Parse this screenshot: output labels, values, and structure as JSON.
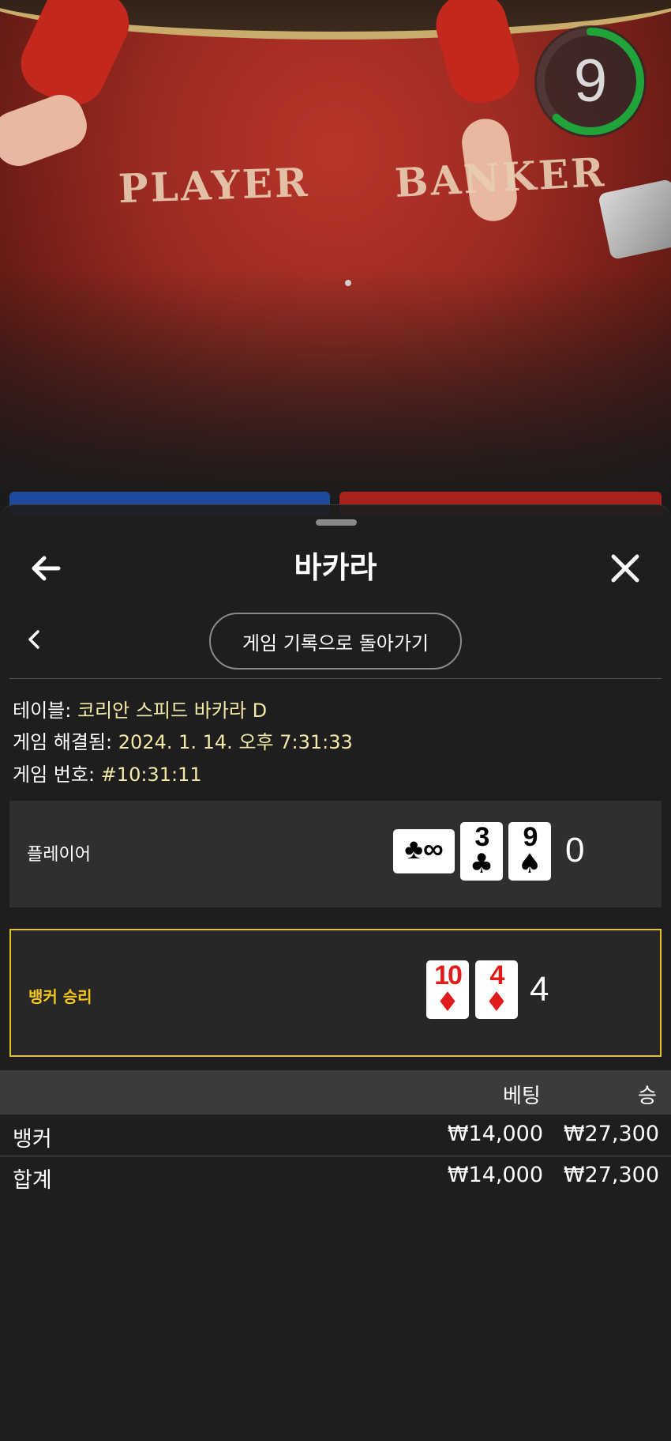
{
  "video": {
    "table_labels": {
      "player": "PLAYER",
      "banker": "BANKER"
    },
    "countdown": "9",
    "countdown_fraction": 0.62
  },
  "sheet": {
    "title": "바카라",
    "back_icon": "arrow-left-icon",
    "close_icon": "close-icon",
    "return_button": "게임 기록으로 돌아가기",
    "info": {
      "table_label": "테이블:",
      "table_value": "코리안 스피드 바카라 D",
      "resolved_label": "게임 해결됨:",
      "resolved_value": "2024. 1. 14. 오후 7:31:33",
      "game_no_label": "게임 번호:",
      "game_no_value": "#10:31:11"
    },
    "player": {
      "label": "플레이어",
      "score": "0",
      "cards": [
        {
          "rank": "∞",
          "suit": "♣",
          "color": "#000000"
        },
        {
          "rank": "3",
          "suit": "♣",
          "color": "#000000"
        },
        {
          "rank": "9",
          "suit": "♠",
          "color": "#000000"
        }
      ]
    },
    "banker": {
      "label": "뱅커 승리",
      "score": "4",
      "highlight_color": "#e6c21a",
      "cards": [
        {
          "rank": "10",
          "suit": "♦",
          "color": "#e01b1b"
        },
        {
          "rank": "4",
          "suit": "♦",
          "color": "#e01b1b"
        }
      ]
    },
    "bets": {
      "col_bet": "베팅",
      "col_win": "승",
      "rows": [
        {
          "name": "뱅커",
          "bet": "₩14,000",
          "win": "₩27,300"
        },
        {
          "name": "합계",
          "bet": "₩14,000",
          "win": "₩27,300"
        }
      ]
    }
  }
}
